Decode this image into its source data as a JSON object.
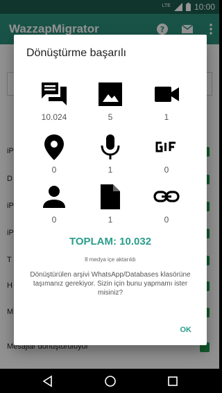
{
  "status_bar": {
    "signal": "LTE",
    "time": "10:00"
  },
  "app_bar": {
    "title": "WazzapMigrator"
  },
  "background_rows": [
    {
      "label": "iP"
    },
    {
      "label": "D"
    },
    {
      "label": "iP"
    },
    {
      "label": "iP"
    },
    {
      "label": "T"
    },
    {
      "label": "H"
    },
    {
      "label": "M"
    },
    {
      "label": "Mesajlar dönüştürülüyor"
    }
  ],
  "dialog": {
    "title": "Dönüştürme başarılı",
    "items": [
      {
        "icon": "chat-icon",
        "count": "10.024"
      },
      {
        "icon": "image-icon",
        "count": "5"
      },
      {
        "icon": "video-icon",
        "count": "1"
      },
      {
        "icon": "location-icon",
        "count": "0"
      },
      {
        "icon": "microphone-icon",
        "count": "1"
      },
      {
        "icon": "gif-icon",
        "count": "0"
      },
      {
        "icon": "person-icon",
        "count": "0"
      },
      {
        "icon": "document-icon",
        "count": "1"
      },
      {
        "icon": "link-icon",
        "count": "0"
      }
    ],
    "total": "TOPLAM: 10.032",
    "media_note": "8 medya içe aktarıldı",
    "question": "Dönüştürülen arşivi WhatsApp/Databases klasörüne taşımanız gerekiyor. Sizin için bunu yapmamı ister misiniz?",
    "ok_label": "OK"
  },
  "colors": {
    "accent": "#2a9d8a",
    "app_bar": "#2b8f7b",
    "status_bar": "#1b5c4f"
  }
}
